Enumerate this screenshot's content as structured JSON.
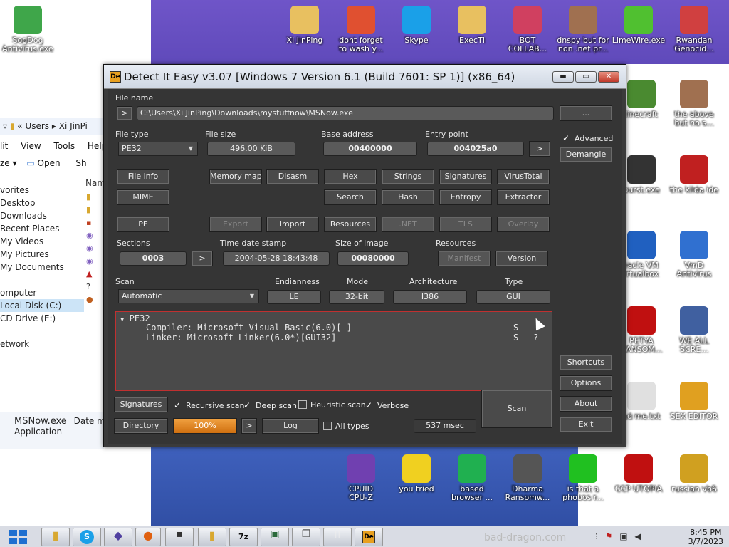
{
  "desktop": {
    "icons_top": [
      {
        "label": "SogDog\nAntivirus.exe",
        "icon": "shield-icon",
        "color": "#3fa64a"
      },
      {
        "label": "Xi JinPing",
        "icon": "folder-user-icon",
        "color": "#e8c060"
      },
      {
        "label": "dont forget\nto wash y...",
        "icon": "broom-icon",
        "color": "#e05030"
      },
      {
        "label": "Skype",
        "icon": "skype-icon",
        "color": "#1aa0e8"
      },
      {
        "label": "ExecTI",
        "icon": "folder-icon",
        "color": "#e8c060"
      },
      {
        "label": "BOT\nCOLLAB...",
        "icon": "monitor-icon",
        "color": "#d04060"
      },
      {
        "label": "dnspy but for\nnon .net pr...",
        "icon": "portrait-icon",
        "color": "#a07050"
      },
      {
        "label": "LimeWire.exe",
        "icon": "limewire-icon",
        "color": "#50c030"
      },
      {
        "label": "Rwandan\nGenocid...",
        "icon": "meme-icon",
        "color": "#d04040"
      }
    ],
    "icons_right": [
      {
        "label": "linecraft",
        "icon": "grass-block-icon",
        "color": "#4a8a30"
      },
      {
        "label": "the above\nbut no s...",
        "icon": "portrait-icon",
        "color": "#a07050"
      },
      {
        "label": "burst.exe",
        "icon": "skull-icon",
        "color": "#333333"
      },
      {
        "label": "the kilda ide",
        "icon": "devcpp-icon",
        "color": "#c02020"
      },
      {
        "label": "racle VM\nirtualbox",
        "icon": "virtualbox-icon",
        "color": "#2060c0"
      },
      {
        "label": "VmD\nAntivirus",
        "icon": "windows-shield-icon",
        "color": "#3070d0"
      },
      {
        "label": "PETYA\nRANSOM...",
        "icon": "skull-red-icon",
        "color": "#c01010"
      },
      {
        "label": "WE ALL\nSCRE...",
        "icon": "computer-icon",
        "color": "#4060a0"
      },
      {
        "label": "ad me.txt",
        "icon": "text-file-icon",
        "color": "#e0e0e0"
      },
      {
        "label": "SEX EDITOR",
        "icon": "hxd-icon",
        "color": "#e0a020"
      }
    ],
    "icons_bottom": [
      {
        "label": "CPUID\nCPU-Z",
        "icon": "cpuz-icon",
        "color": "#7040b0"
      },
      {
        "label": "you tried",
        "icon": "star-icon",
        "color": "#f0d020"
      },
      {
        "label": "based\nbrowser ...",
        "icon": "browser-icon",
        "color": "#20b050"
      },
      {
        "label": "Dharma\nRansomw...",
        "icon": "skull-headphones-icon",
        "color": "#555555"
      },
      {
        "label": "is that a\nphobos r...",
        "icon": "icq-icon",
        "color": "#20c020"
      },
      {
        "label": "CCP UTOPIA",
        "icon": "ccp-icon",
        "color": "#c01010"
      },
      {
        "label": "russian vb6",
        "icon": "vb6-icon",
        "color": "#d0a020"
      }
    ]
  },
  "explorer": {
    "address": [
      "Users",
      "Xi JinPi"
    ],
    "menu": [
      "lit",
      "View",
      "Tools",
      "Help"
    ],
    "toolbar": [
      "ze",
      "Open",
      "Sh"
    ],
    "col_header": "Nam",
    "nav": [
      "vorites",
      "Desktop",
      "Downloads",
      "Recent Places",
      "My Videos",
      "My Pictures",
      "My Documents",
      "",
      "omputer",
      "Local Disk (C:)",
      "CD Drive (E:)",
      "",
      "etwork"
    ],
    "status_name": "MSNow.exe",
    "status_datelabel": "Date mo",
    "status_type": "Application"
  },
  "die": {
    "title": "Detect It Easy v3.07 [Windows 7 Version 6.1 (Build 7601: SP 1)] (x86_64)",
    "logo": "De",
    "file_name_label": "File name",
    "file_path": "C:\\Users\\Xi JinPing\\Downloads\\mystuffnow\\MSNow.exe",
    "browse_label": "...",
    "file_type_label": "File type",
    "file_type": "PE32",
    "file_size_label": "File size",
    "file_size": "496.00 KiB",
    "base_address_label": "Base address",
    "base_address": "00400000",
    "entry_point_label": "Entry point",
    "entry_point": "004025a0",
    "advanced_label": "Advanced",
    "demangle_label": "Demangle",
    "buttons_row1": [
      "File info",
      "Memory map",
      "Disasm",
      "Hex",
      "Strings",
      "Signatures",
      "VirusTotal"
    ],
    "buttons_row2": [
      "MIME",
      "Search",
      "Hash",
      "Entropy",
      "Extractor"
    ],
    "buttons_row3": [
      "PE",
      "Export",
      "Import",
      "Resources",
      ".NET",
      "TLS",
      "Overlay"
    ],
    "sections_label": "Sections",
    "sections": "0003",
    "timestamp_label": "Time date stamp",
    "timestamp": "2004-05-28 18:43:48",
    "image_size_label": "Size of image",
    "image_size": "00080000",
    "resources_label": "Resources",
    "manifest_label": "Manifest",
    "version_label": "Version",
    "scan_label": "Scan",
    "scan_mode": "Automatic",
    "endianness_label": "Endianness",
    "endianness": "LE",
    "mode_label": "Mode",
    "mode": "32-bit",
    "architecture_label": "Architecture",
    "architecture": "I386",
    "type_label": "Type",
    "type": "GUI",
    "results": {
      "root": "PE32",
      "rows": [
        {
          "text": "Compiler: Microsoft Visual Basic(6.0)[-]",
          "flag": "S",
          "extra": ""
        },
        {
          "text": "Linker: Microsoft Linker(6.0*)[GUI32]",
          "flag": "S",
          "extra": "?"
        }
      ]
    },
    "shortcuts_label": "Shortcuts",
    "options_label": "Options",
    "about_label": "About",
    "exit_label": "Exit",
    "signatures_label": "Signatures",
    "recursive_label": "Recursive scan",
    "deep_label": "Deep scan",
    "heuristic_label": "Heuristic scan",
    "verbose_label": "Verbose",
    "directory_label": "Directory",
    "progress_text": "100%",
    "progress_value": 1.0,
    "log_label": "Log",
    "all_types_label": "All types",
    "time_label": "537 msec",
    "scan_button": "Scan",
    "accent": "#e08a20"
  },
  "taskbar": {
    "watermark": "bad-dragon.com",
    "time": "8:45 PM",
    "date": "3/7/2023"
  }
}
